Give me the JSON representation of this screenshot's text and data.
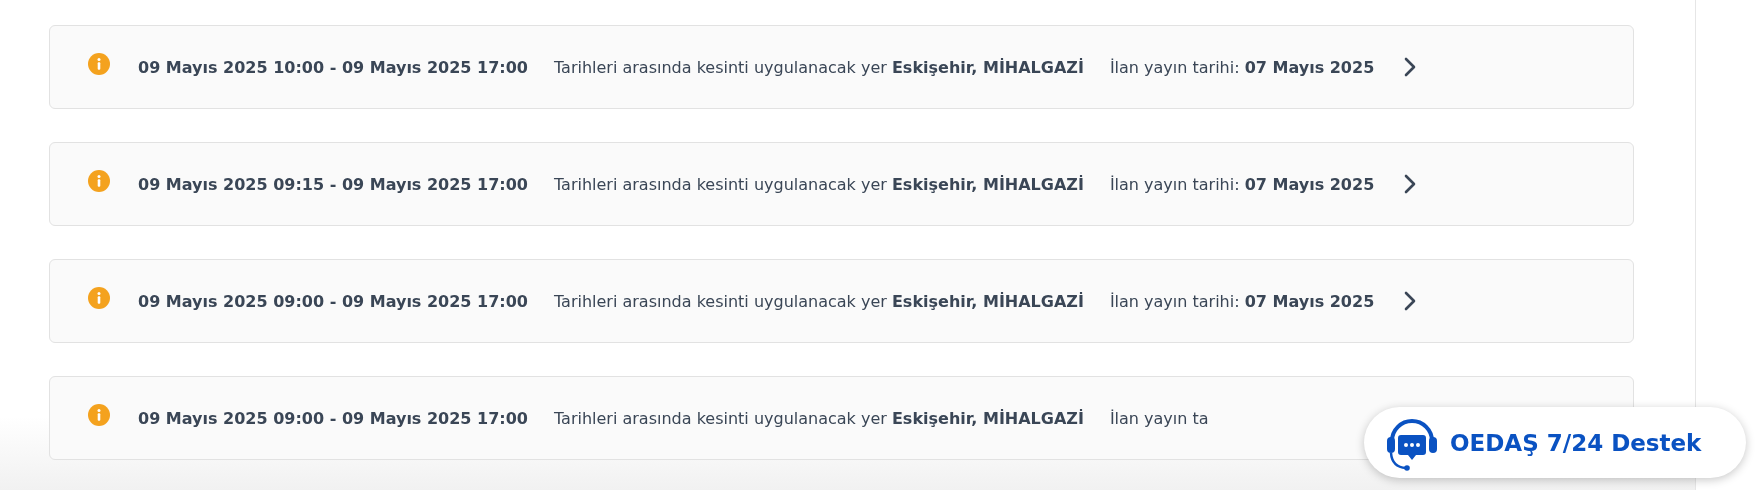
{
  "notices": [
    {
      "date_range": "09 Mayıs 2025 10:00 - 09 Mayıs 2025 17:00",
      "location_text": "Tarihleri arasında kesinti uygulanacak yer **Eskişehir, MİHALGAZİ**",
      "published_text": "İlan yayın tarihi: **07 Mayıs 2025**",
      "chevron": true
    },
    {
      "date_range": "09 Mayıs 2025 09:15 - 09 Mayıs 2025 17:00",
      "location_text": "Tarihleri arasında kesinti uygulanacak yer **Eskişehir, MİHALGAZİ**",
      "published_text": "İlan yayın tarihi: **07 Mayıs 2025**",
      "chevron": true
    },
    {
      "date_range": "09 Mayıs 2025 09:00 - 09 Mayıs 2025 17:00",
      "location_text": "Tarihleri arasında kesinti uygulanacak yer **Eskişehir, MİHALGAZİ**",
      "published_text": "İlan yayın tarihi: **07 Mayıs 2025**",
      "chevron": true
    },
    {
      "date_range": "09 Mayıs 2025 09:00 - 09 Mayıs 2025 17:00",
      "location_text": "Tarihleri arasında kesinti uygulanacak yer **Eskişehir, MİHALGAZİ**",
      "published_text": "İlan yayın ta",
      "chevron": false
    }
  ],
  "support_button": {
    "label": "OEDAŞ 7/24 Destek"
  }
}
